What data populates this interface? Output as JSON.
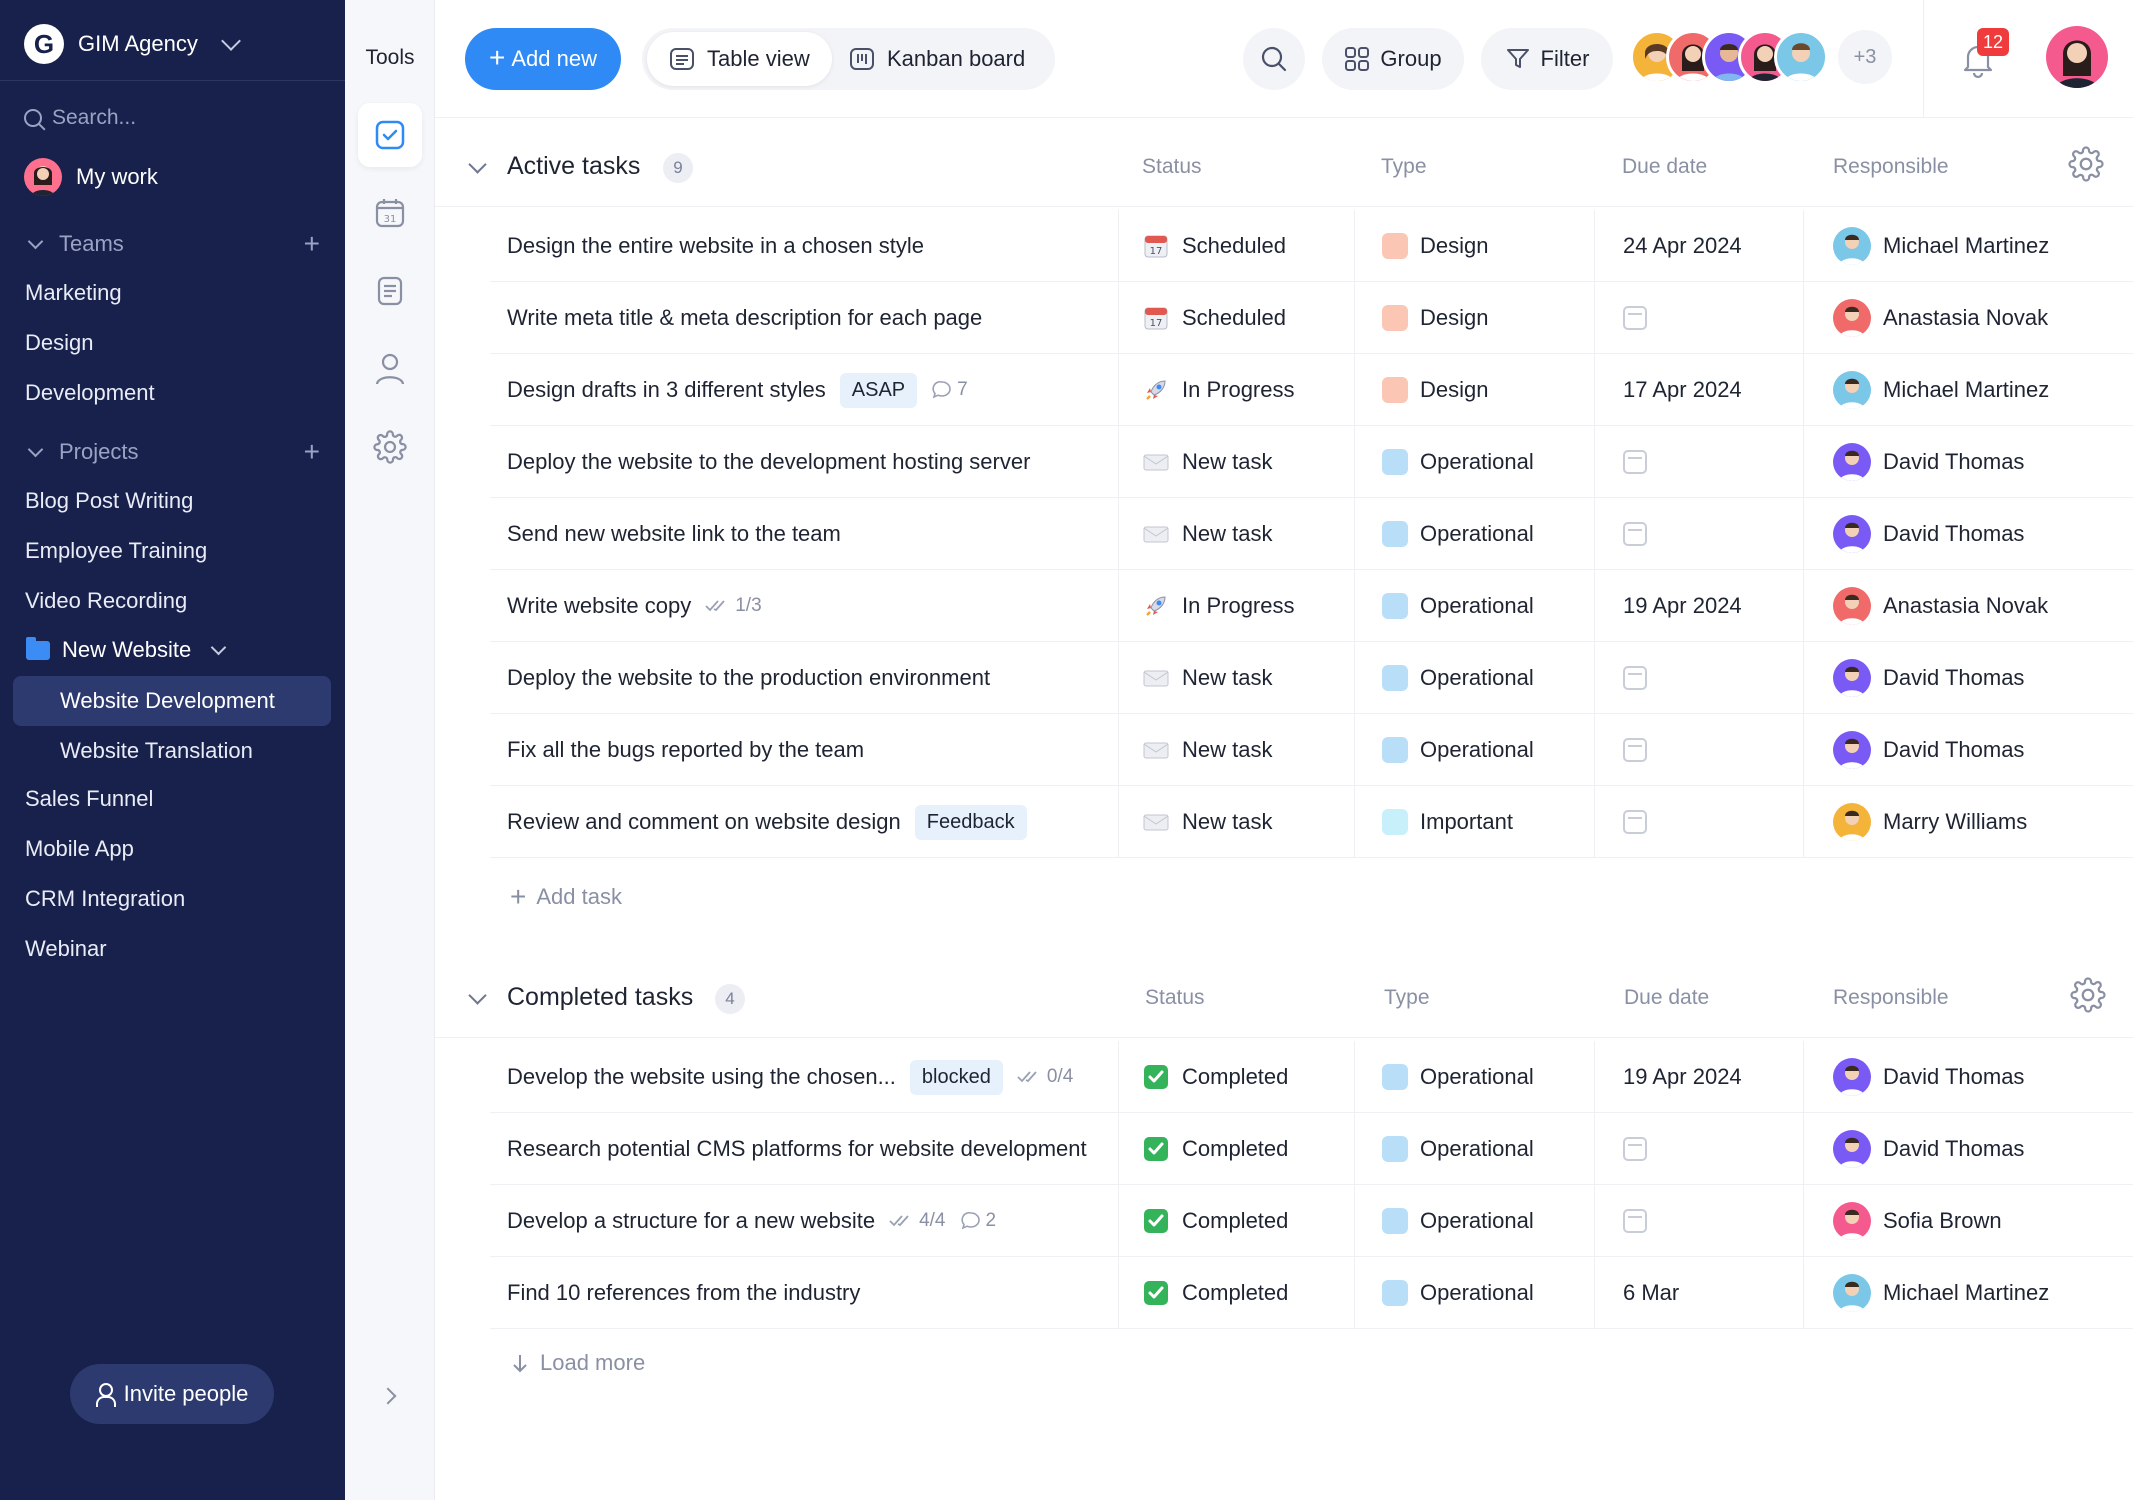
{
  "workspace": {
    "name": "GIM Agency",
    "logo_letter": "G"
  },
  "sidebar": {
    "search_placeholder": "Search...",
    "my_work": "My work",
    "teams_label": "Teams",
    "teams": [
      "Marketing",
      "Design",
      "Development"
    ],
    "projects_label": "Projects",
    "projects_top": [
      "Blog Post Writing",
      "Employee Training",
      "Video Recording"
    ],
    "folder": {
      "name": "New Website",
      "children": [
        "Website Development",
        "Website Translation"
      ]
    },
    "projects_bottom": [
      "Sales Funnel",
      "Mobile App",
      "CRM Integration",
      "Webinar"
    ],
    "invite_label": "Invite people"
  },
  "tools": {
    "title": "Tools",
    "calendar_day": "31"
  },
  "topbar": {
    "add_new": "Add new",
    "table_view": "Table view",
    "kanban_board": "Kanban board",
    "group": "Group",
    "filter": "Filter",
    "extra_members": "+3",
    "notifications": "12"
  },
  "columns": {
    "status": "Status",
    "type": "Type",
    "due": "Due date",
    "responsible": "Responsible"
  },
  "active": {
    "title": "Active tasks",
    "count": "9",
    "add_label": "Add task",
    "rows": [
      {
        "task": "Design the entire website in a chosen style",
        "status": "Scheduled",
        "type": "Design",
        "due": "24 Apr 2024",
        "responsible": "Michael Martinez"
      },
      {
        "task": "Write meta title & meta description for each page",
        "status": "Scheduled",
        "type": "Design",
        "due": "",
        "responsible": "Anastasia Novak"
      },
      {
        "task": "Design drafts in 3 different styles",
        "tag": "ASAP",
        "comments": "7",
        "status": "In Progress",
        "type": "Design",
        "due": "17 Apr 2024",
        "responsible": "Michael Martinez"
      },
      {
        "task": "Deploy the website to the development hosting server",
        "status": "New task",
        "type": "Operational",
        "due": "",
        "responsible": "David Thomas"
      },
      {
        "task": "Send new website link to the team",
        "status": "New task",
        "type": "Operational",
        "due": "",
        "responsible": "David Thomas"
      },
      {
        "task": "Write website copy",
        "checklist": "1/3",
        "status": "In Progress",
        "type": "Operational",
        "due": "19 Apr 2024",
        "responsible": "Anastasia Novak"
      },
      {
        "task": "Deploy the website to the production environment",
        "status": "New task",
        "type": "Operational",
        "due": "",
        "responsible": "David Thomas"
      },
      {
        "task": "Fix all the bugs reported by the team",
        "status": "New task",
        "type": "Operational",
        "due": "",
        "responsible": "David Thomas"
      },
      {
        "task": "Review and comment on website design",
        "tag": "Feedback",
        "status": "New task",
        "type": "Important",
        "due": "",
        "responsible": "Marry Williams"
      }
    ]
  },
  "completed": {
    "title": "Completed tasks",
    "count": "4",
    "load_more": "Load more",
    "rows": [
      {
        "task": "Develop the website using the chosen...",
        "tag": "blocked",
        "checklist": "0/4",
        "status": "Completed",
        "type": "Operational",
        "due": "19 Apr 2024",
        "responsible": "David Thomas"
      },
      {
        "task": "Research potential CMS platforms for website development",
        "status": "Completed",
        "type": "Operational",
        "due": "",
        "responsible": "David Thomas"
      },
      {
        "task": "Develop a structure for a new website",
        "checklist": "4/4",
        "comments": "2",
        "status": "Completed",
        "type": "Operational",
        "due": "",
        "responsible": "Sofia Brown"
      },
      {
        "task": "Find 10 references from the industry",
        "status": "Completed",
        "type": "Operational",
        "due": "6 Mar",
        "responsible": "Michael Martinez"
      }
    ]
  },
  "colors": {
    "sidebar_bg": "#17214b",
    "accent": "#2f8af5",
    "type_design": "#fbc6b3",
    "type_operational": "#b9def8",
    "type_important": "#c8f0fb"
  }
}
